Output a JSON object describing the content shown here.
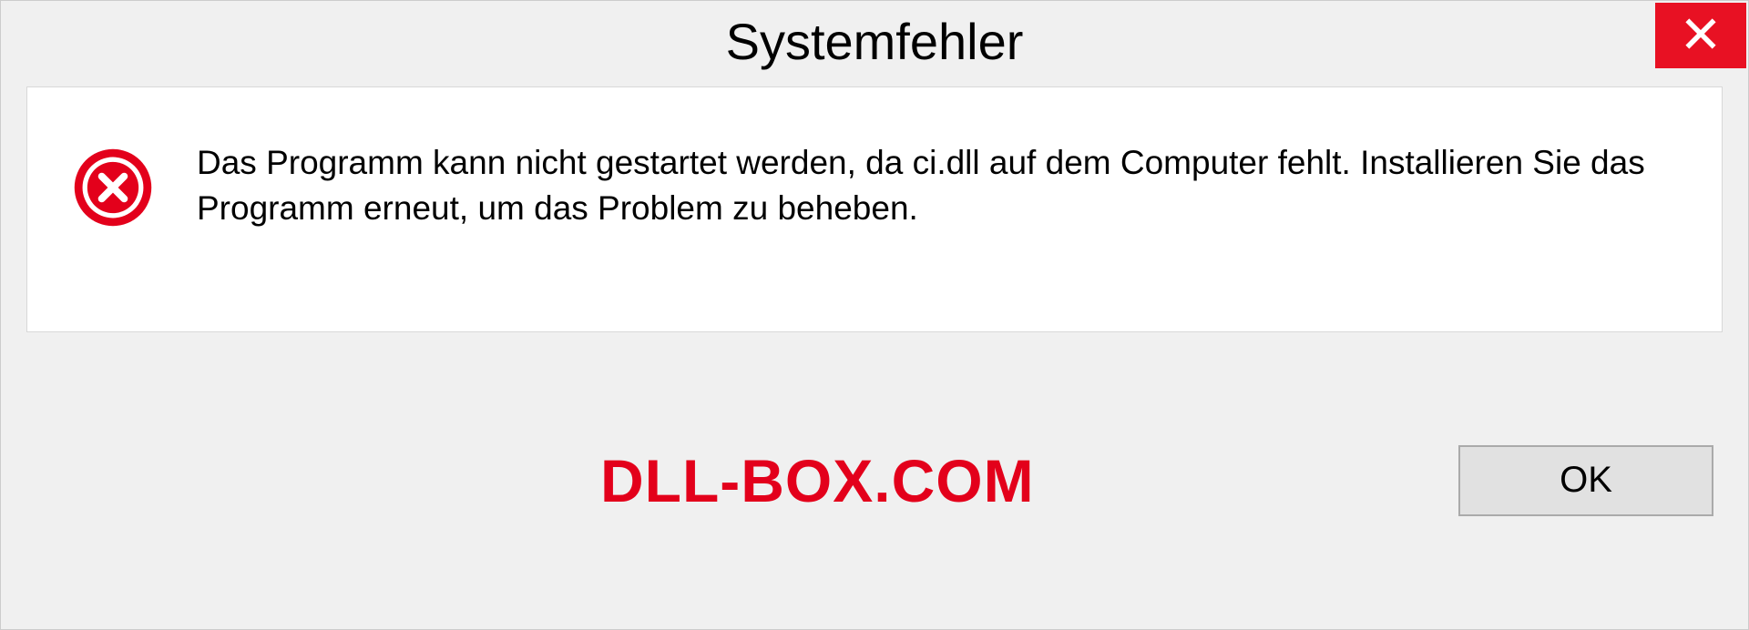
{
  "dialog": {
    "title": "Systemfehler",
    "message": "Das Programm kann nicht gestartet werden, da ci.dll auf dem Computer fehlt. Installieren Sie das Programm erneut, um das Problem zu beheben.",
    "ok_label": "OK"
  },
  "watermark": "DLL-BOX.COM",
  "colors": {
    "close_bg": "#e81123",
    "error_icon_bg": "#e3001b",
    "watermark": "#e3001b"
  }
}
